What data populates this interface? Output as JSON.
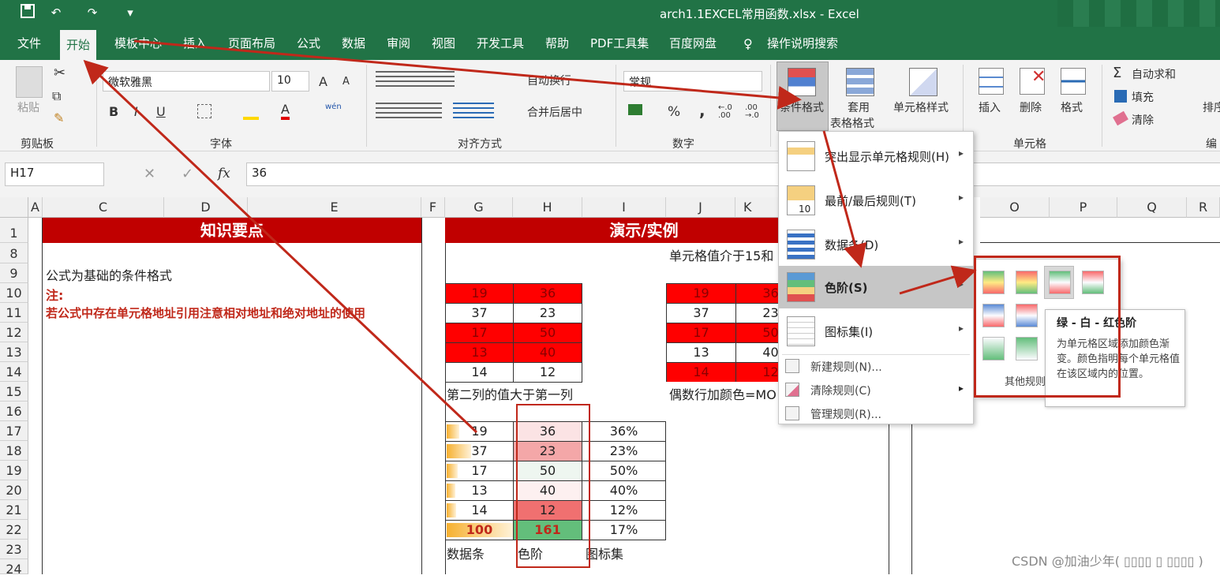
{
  "window": {
    "title": "arch1.1EXCEL常用函数.xlsx  -  Excel",
    "qa_more": "▾"
  },
  "tabs": [
    "文件",
    "开始",
    "模板中心",
    "插入",
    "页面布局",
    "公式",
    "数据",
    "审阅",
    "视图",
    "开发工具",
    "帮助",
    "PDF工具集",
    "百度网盘",
    "操作说明搜索"
  ],
  "ribbon": {
    "clipboard": {
      "paste": "粘贴",
      "group": "剪贴板"
    },
    "font": {
      "name": "微软雅黑",
      "size": "10",
      "bold": "B",
      "italic": "I",
      "underline": "U",
      "group": "字体",
      "grow": "A",
      "shrink": "A",
      "fontcolor": "A",
      "wen": "wén"
    },
    "align": {
      "wrap": "自动换行",
      "merge": "合并后居中",
      "group": "对齐方式"
    },
    "number": {
      "format": "常规",
      "percent": "%",
      "comma": ",",
      "group": "数字",
      "inc": "←.0 .00",
      "dec": ".00 →.0"
    },
    "styles": {
      "cf_line1": "条件格式",
      "table_l1": "套用",
      "table_l2": "表格格式",
      "cellstyle": "单元格样式"
    },
    "cells": {
      "insert": "插入",
      "delete": "删除",
      "format": "格式",
      "group": "单元格"
    },
    "editing": {
      "autosum": "自动求和",
      "fill": "填充",
      "clear": "清除",
      "sort": "排序",
      "group": "编"
    }
  },
  "formula_bar": {
    "name_box": "H17",
    "fx": "fx",
    "value": "36"
  },
  "columns": [
    "A",
    "C",
    "D",
    "E",
    "F",
    "G",
    "H",
    "I",
    "J",
    "K",
    "O",
    "P",
    "Q",
    "R"
  ],
  "rows": [
    "1",
    "8",
    "9",
    "10",
    "11",
    "12",
    "13",
    "14",
    "15",
    "16",
    "17",
    "18",
    "19",
    "20",
    "21",
    "22",
    "23",
    "24"
  ],
  "sheet": {
    "header_left": "知识要点",
    "header_right": "演示/实例",
    "j8": "单元格值介于15和",
    "c9": "公式为基础的条件格式",
    "c10": "注:",
    "c11": "若公式中存在单元格地址引用注意相对地址和绝对地址的使用",
    "g15": "第二列的值大于第一列",
    "j15": "偶数行加颜色=MO",
    "g23": "数据条",
    "h23": "色阶",
    "i23": "图标集",
    "table1": [
      [
        "19",
        "36"
      ],
      [
        "37",
        "23"
      ],
      [
        "17",
        "50"
      ],
      [
        "13",
        "40"
      ],
      [
        "14",
        "12"
      ]
    ],
    "table1_red": [
      true,
      false,
      true,
      true,
      false
    ],
    "table2": [
      [
        "19",
        "36"
      ],
      [
        "37",
        "23"
      ],
      [
        "17",
        "50"
      ],
      [
        "13",
        "40"
      ],
      [
        "14",
        "12"
      ]
    ],
    "table2_red": [
      true,
      false,
      true,
      false,
      true
    ],
    "table3": [
      [
        "19",
        "36",
        "36%"
      ],
      [
        "37",
        "23",
        "23%"
      ],
      [
        "17",
        "50",
        "50%"
      ],
      [
        "13",
        "40",
        "40%"
      ],
      [
        "14",
        "12",
        "12%"
      ],
      [
        "100",
        "161",
        "17%"
      ]
    ],
    "table3_bars": [
      0.19,
      0.37,
      0.17,
      0.13,
      0.14,
      1.0
    ],
    "table3_colors": [
      "#fbe3e4",
      "#f4a7a8",
      "#eef6f0",
      "#fdf0f0",
      "#f07070",
      "#63be7b"
    ]
  },
  "cf_menu": {
    "items": [
      "突出显示单元格规则(H)",
      "最前/最后规则(T)",
      "数据条(D)",
      "色阶(S)",
      "图标集(I)"
    ],
    "small": [
      "新建规则(N)...",
      "清除规则(C)",
      "管理规则(R)..."
    ],
    "icon_text_1": "10"
  },
  "submenu": {
    "more": "其他规则"
  },
  "tooltip": {
    "title": "绿 - 白 - 红色阶",
    "body": "为单元格区域添加颜色渐变。颜色指明每个单元格值在该区域内的位置。"
  },
  "watermark": "CSDN @加油少年( ▯▯▯▯ ▯ ▯▯▯▯ )",
  "colors": {
    "excel_green": "#217346",
    "header_red": "#c00000",
    "annot_red": "#c0281a"
  }
}
